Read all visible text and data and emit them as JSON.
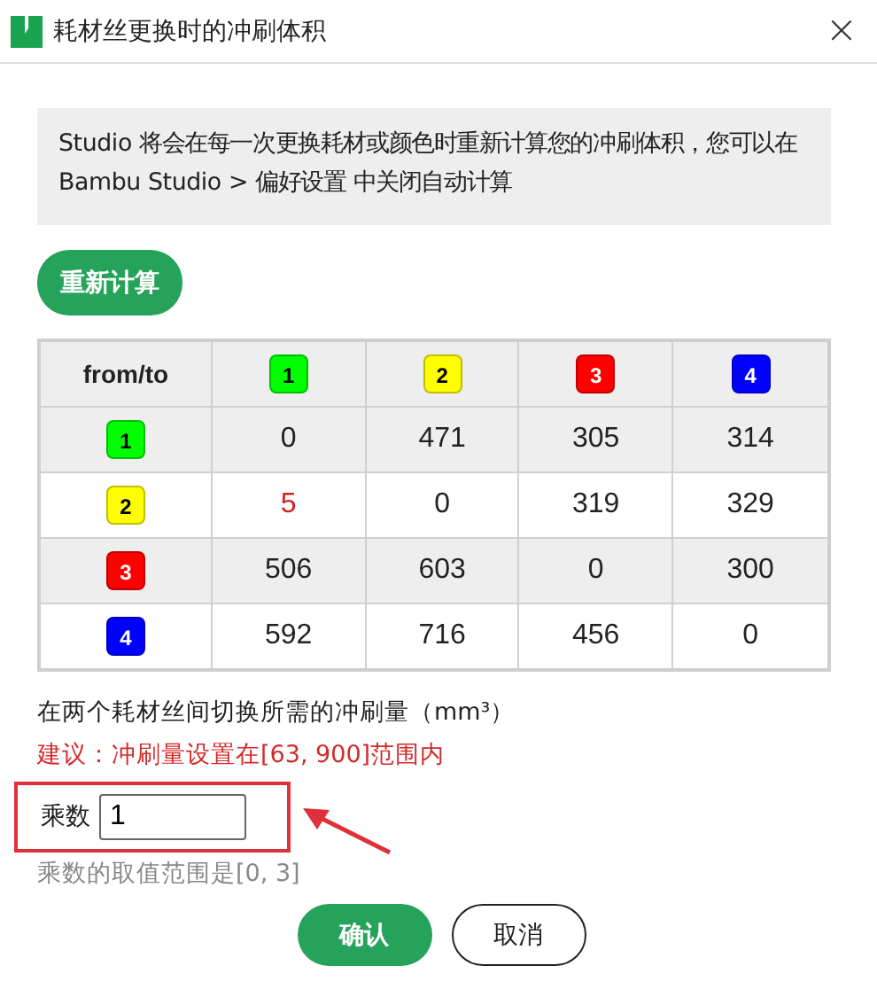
{
  "window": {
    "title": "耗材丝更换时的冲刷体积",
    "close": "×"
  },
  "info": "Studio 将会在每一次更换耗材或颜色时重新计算您的冲刷体积，您可以在Bambu Studio > 偏好设置 中关闭自动计算",
  "recalc_button": "重新计算",
  "table": {
    "corner": "from/to",
    "filaments": [
      {
        "label": "1",
        "color": "#00ff00"
      },
      {
        "label": "2",
        "color": "#ffff00"
      },
      {
        "label": "3",
        "color": "#ff0000"
      },
      {
        "label": "4",
        "color": "#0000ff"
      }
    ],
    "rows": [
      {
        "from": {
          "label": "1",
          "color": "#00ff00"
        },
        "cells": [
          {
            "value": "0",
            "warning": false
          },
          {
            "value": "471",
            "warning": false
          },
          {
            "value": "305",
            "warning": false
          },
          {
            "value": "314",
            "warning": false
          }
        ]
      },
      {
        "from": {
          "label": "2",
          "color": "#ffff00"
        },
        "cells": [
          {
            "value": "5",
            "warning": true
          },
          {
            "value": "0",
            "warning": false
          },
          {
            "value": "319",
            "warning": false
          },
          {
            "value": "329",
            "warning": false
          }
        ]
      },
      {
        "from": {
          "label": "3",
          "color": "#ff0000"
        },
        "cells": [
          {
            "value": "506",
            "warning": false
          },
          {
            "value": "603",
            "warning": false
          },
          {
            "value": "0",
            "warning": false
          },
          {
            "value": "300",
            "warning": false
          }
        ]
      },
      {
        "from": {
          "label": "4",
          "color": "#0000ff"
        },
        "cells": [
          {
            "value": "592",
            "warning": false
          },
          {
            "value": "716",
            "warning": false
          },
          {
            "value": "456",
            "warning": false
          },
          {
            "value": "0",
            "warning": false
          }
        ]
      }
    ]
  },
  "unit_note": "在两个耗材丝间切换所需的冲刷量（mm³）",
  "suggestion": "建议：冲刷量设置在[63, 900]范围内",
  "multiplier": {
    "label": "乘数",
    "value": "1",
    "highlighted": true
  },
  "range_note": "乘数的取值范围是[0, 3]",
  "buttons": [
    {
      "label": "确认",
      "kind": "primary"
    },
    {
      "label": "取消",
      "kind": "secondary"
    }
  ]
}
